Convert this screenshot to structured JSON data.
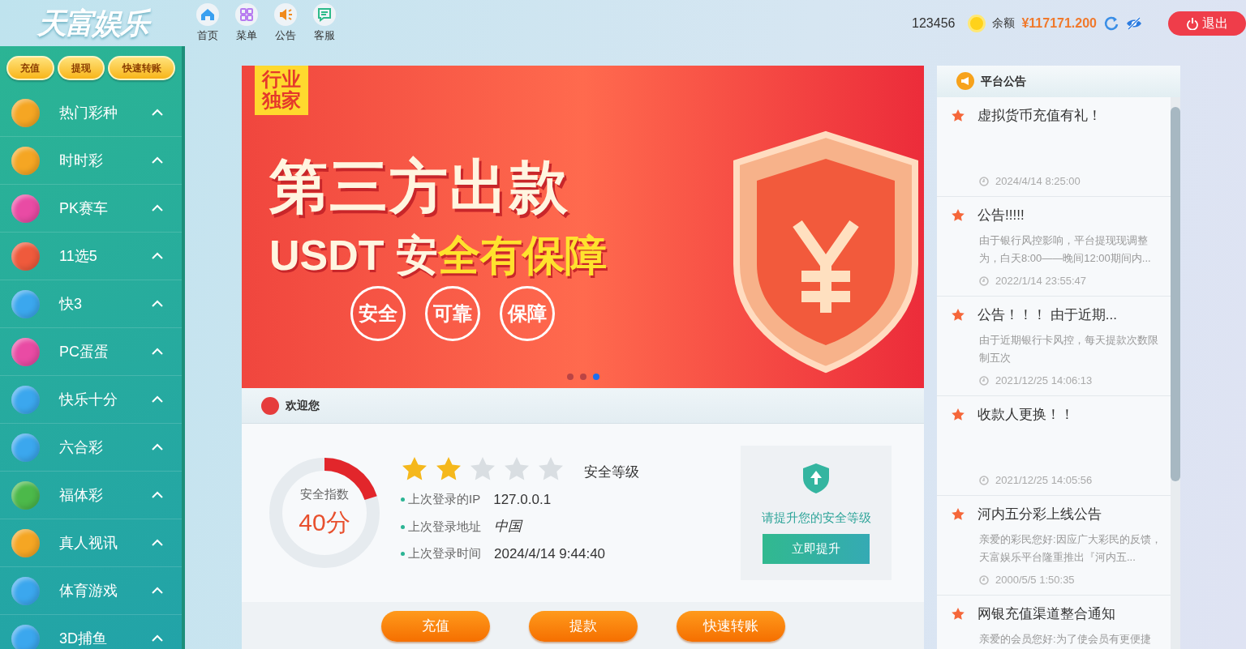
{
  "brand": {
    "logo": "天富娱乐"
  },
  "nav": [
    {
      "label": "首页"
    },
    {
      "label": "菜单"
    },
    {
      "label": "公告"
    },
    {
      "label": "客服"
    }
  ],
  "account": {
    "username": "123456",
    "balance_label": "余额",
    "balance": "¥117171.200",
    "logout": "退出"
  },
  "quick_buttons": [
    "充值",
    "提现",
    "快速转账"
  ],
  "sidebar": {
    "items": [
      {
        "label": "热门彩种",
        "color": "#f5a623"
      },
      {
        "label": "时时彩",
        "color": "#f5a623"
      },
      {
        "label": "PK赛车",
        "color": "#e94ba4"
      },
      {
        "label": "11选5",
        "color": "#ef5a3c"
      },
      {
        "label": "快3",
        "color": "#3ba7ee"
      },
      {
        "label": "PC蛋蛋",
        "color": "#e94ba4"
      },
      {
        "label": "快乐十分",
        "color": "#3ba7ee"
      },
      {
        "label": "六合彩",
        "color": "#3ba7ee"
      },
      {
        "label": "福体彩",
        "color": "#4cb94a"
      },
      {
        "label": "真人视讯",
        "color": "#f5a623"
      },
      {
        "label": "体育游戏",
        "color": "#3ba7ee"
      },
      {
        "label": "3D捕鱼",
        "color": "#3ba7ee"
      }
    ]
  },
  "banner": {
    "tag": "行业独家",
    "headline": "第三方出款",
    "subline": [
      {
        "text": "USDT 安",
        "highlight": false
      },
      {
        "text": "全有保障",
        "highlight": true
      }
    ],
    "badges": [
      "安全",
      "可靠",
      "保障"
    ],
    "dots": [
      {
        "selected": false
      },
      {
        "selected": false
      },
      {
        "selected": true
      }
    ]
  },
  "welcome": {
    "title": "欢迎您",
    "score_label": "安全指数",
    "score": "40分",
    "level": 0.2,
    "stars": 2,
    "stars_label": "安全等级",
    "info": [
      {
        "label": "上次登录的IP",
        "value": "127.0.0.1",
        "italic": false
      },
      {
        "label": "上次登录地址",
        "value": "中国",
        "italic": true
      },
      {
        "label": "上次登录时间",
        "value": "2024/4/14 9:44:40",
        "italic": false
      }
    ],
    "upgrade_text": "请提升您的安全等级",
    "upgrade_button": "立即提升",
    "actions": [
      "充值",
      "提款",
      "快速转账"
    ]
  },
  "notices": {
    "title": "平台公告",
    "items": [
      {
        "title": "虚拟货币充值有礼！",
        "time": "2024/4/14 8:25:00"
      },
      {
        "title": "公告!!!!!",
        "body": "由于银行风控影响，平台提现现调整为，白天8:00——晚间12:00期间内...",
        "time": "2022/1/14 23:55:47"
      },
      {
        "title": "公告！！！ 由于近期...",
        "body": "由于近期银行卡风控，每天提款次数限制五次",
        "time": "2021/12/25 14:06:13"
      },
      {
        "title": "收款人更换！！",
        "time": "2021/12/25 14:05:56"
      },
      {
        "title": "河内五分彩上线公告",
        "body": "亲爱的彩民您好:因应广大彩民的反馈，天富娱乐平台隆重推出『河内五...",
        "time": "2000/5/5 1:50:35"
      },
      {
        "title": "网银充值渠道整合通知",
        "body": "亲爱的会员您好:为了使会员有更便捷"
      }
    ]
  }
}
